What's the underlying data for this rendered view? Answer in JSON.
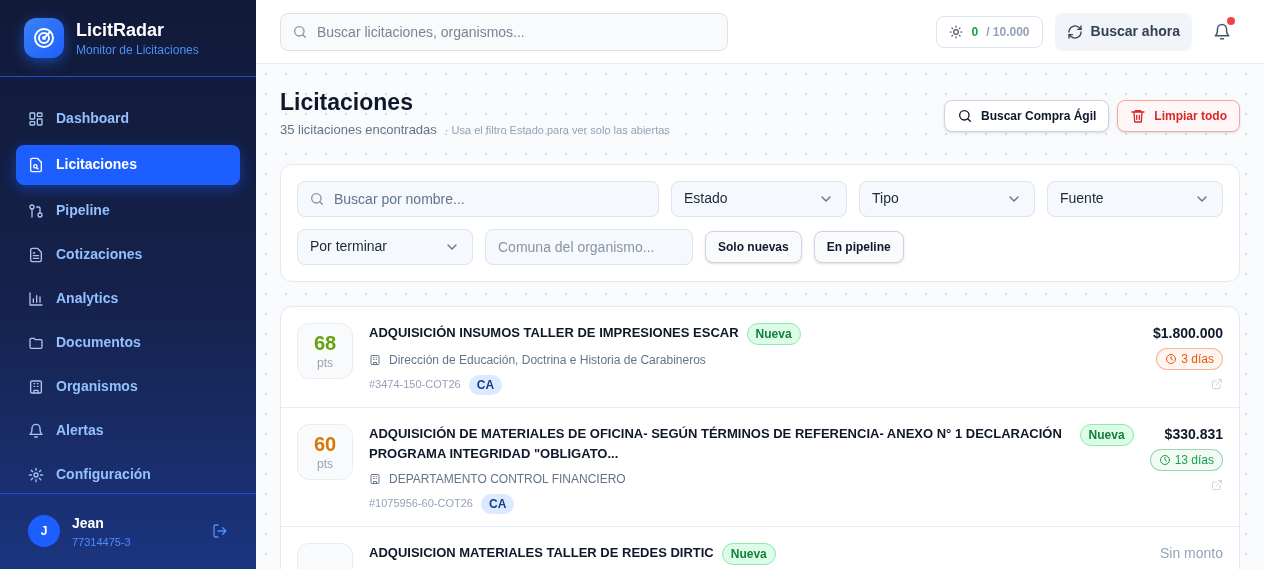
{
  "brand": {
    "name": "LicitRadar",
    "tagline": "Monitor de Licitaciones"
  },
  "sidebar": {
    "items": [
      {
        "label": "Dashboard",
        "selected": false
      },
      {
        "label": "Licitaciones",
        "selected": true
      },
      {
        "label": "Pipeline",
        "selected": false
      },
      {
        "label": "Cotizaciones",
        "selected": false
      },
      {
        "label": "Analytics",
        "selected": false
      },
      {
        "label": "Documentos",
        "selected": false
      },
      {
        "label": "Organismos",
        "selected": false
      },
      {
        "label": "Alertas",
        "selected": false
      },
      {
        "label": "Configuración",
        "selected": false
      }
    ],
    "user": {
      "initial": "J",
      "name": "Jean",
      "id": "77314475-3"
    }
  },
  "topbar": {
    "search": {
      "placeholder": "Buscar licitaciones, organismos..."
    },
    "quota": {
      "used": "0",
      "total": "/ 10.000"
    },
    "search_button": "Buscar ahora",
    "notifications": {
      "unread": true
    }
  },
  "page": {
    "title": "Licitaciones",
    "count": "35 licitaciones encontradas",
    "hint": "· Usa el filtro Estado para ver solo las abiertas",
    "actions": [
      {
        "label": "Buscar Compra Ágil",
        "kind": "search"
      },
      {
        "label": "Limpiar todo",
        "kind": "danger"
      }
    ]
  },
  "filters": {
    "search": {
      "placeholder": "Buscar por nombre..."
    },
    "selects": [
      {
        "label": "Estado"
      },
      {
        "label": "Tipo"
      },
      {
        "label": "Fuente"
      }
    ],
    "deadline": {
      "label": "Por terminar"
    },
    "commune": {
      "placeholder": "Comuna del organismo..."
    },
    "toggles": [
      {
        "label": "Solo nuevas",
        "on": false
      },
      {
        "label": "En pipeline",
        "on": false
      }
    ]
  },
  "results": [
    {
      "score": "68",
      "score_unit": "pts",
      "color": "#65a30d",
      "title": "ADQUISICIÓN INSUMOS TALLER DE IMPRESIONES ESCAR",
      "badge": "Nueva",
      "agency": "Dirección de Educación, Doctrina e Historia de Carabineros",
      "code": "#3474-150-COT26",
      "type": "CA",
      "amount": "$1.800.000",
      "deadline": {
        "text": "3 días",
        "color": "#ea580c"
      }
    },
    {
      "score": "60",
      "score_unit": "pts",
      "color": "#d97706",
      "title": "ADQUISICIÓN DE MATERIALES DE OFICINA- SEGÚN TÉRMINOS DE REFERENCIA- ANEXO N° 1 DECLARACIÓN PROGRAMA INTEGRIDAD \"OBLIGATO...",
      "badge": "Nueva",
      "agency": "DEPARTAMENTO CONTROL FINANCIERO",
      "code": "#1075956-60-COT26",
      "type": "CA",
      "amount": "$330.831",
      "deadline": {
        "text": "13 días",
        "color": "#16a34a"
      }
    },
    {
      "title": "ADQUISICION MATERIALES TALLER DE REDES DIRTIC",
      "badge": "Nueva",
      "amount": "Sin monto",
      "no_amount": true
    }
  ]
}
